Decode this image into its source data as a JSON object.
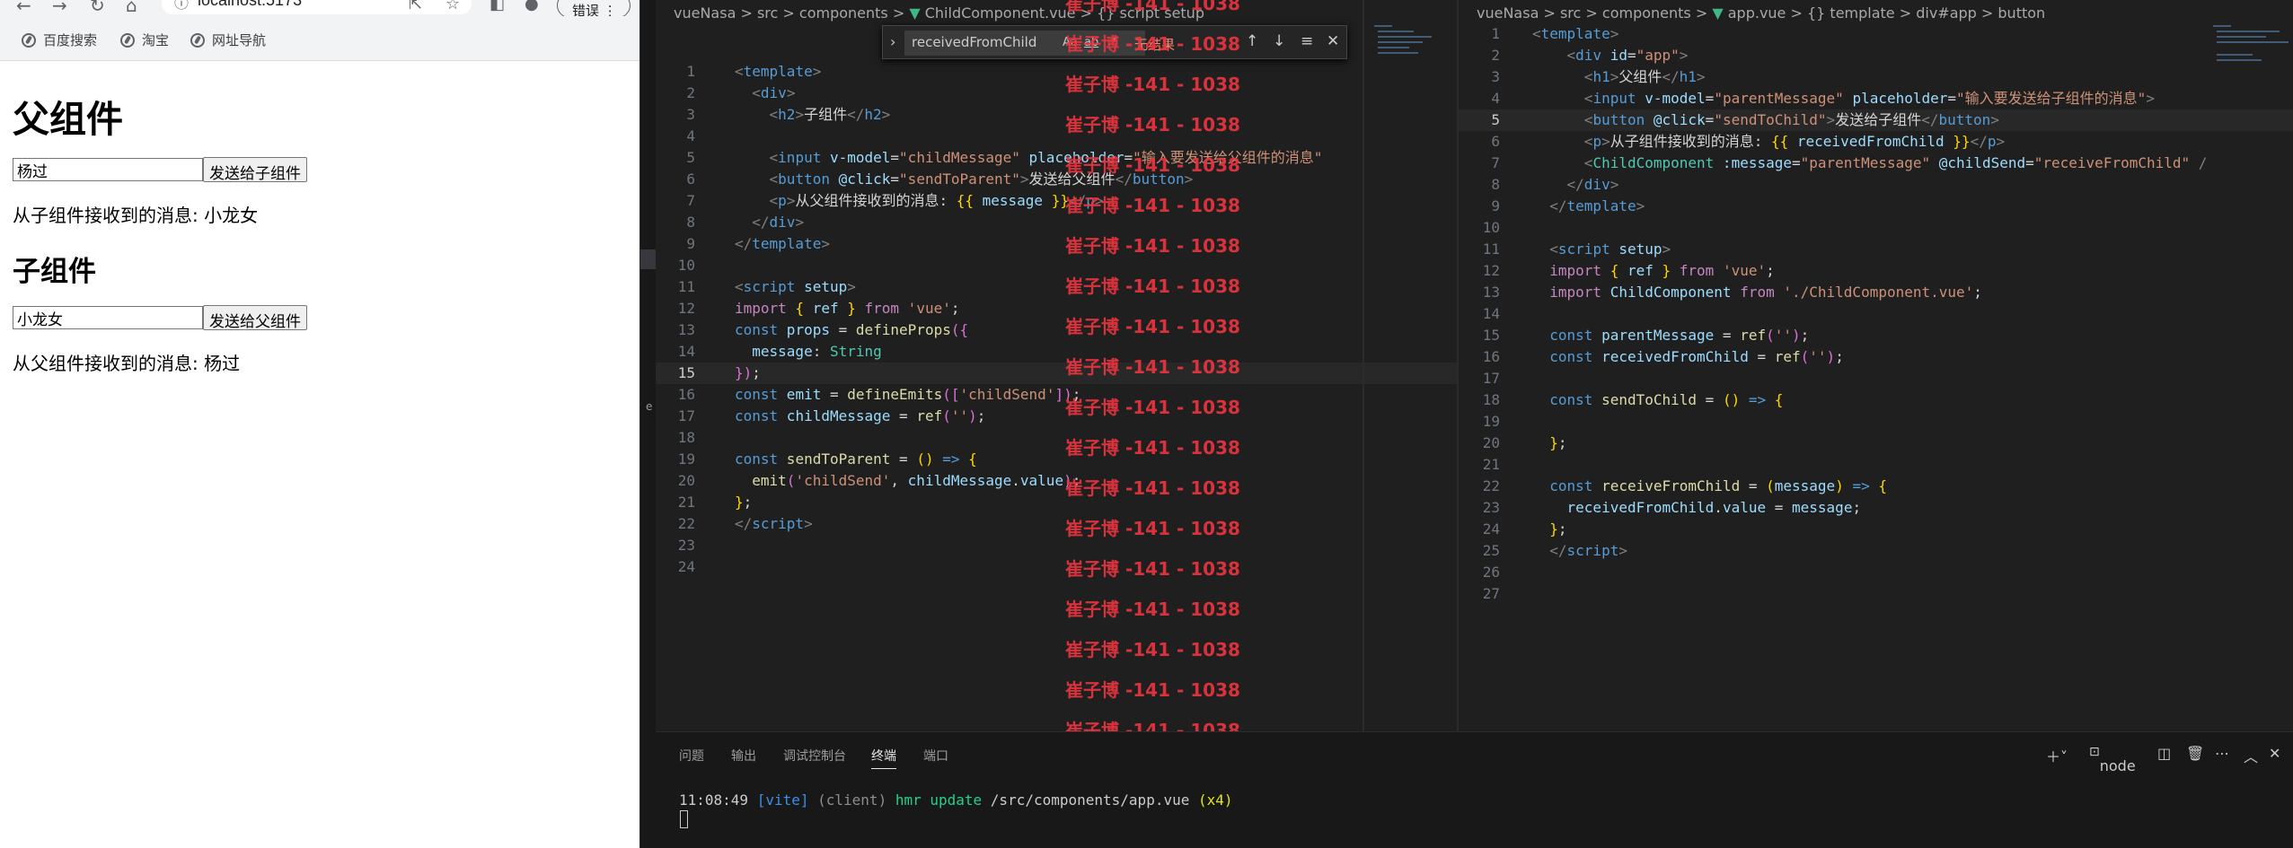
{
  "browser": {
    "url": "localhost:5173",
    "error_button": "错误",
    "bookmarks": [
      "百度搜索",
      "淘宝",
      "网址导航"
    ]
  },
  "page": {
    "parent_title": "父组件",
    "parent_input_value": "杨过",
    "parent_button": "发送给子组件",
    "parent_received": "从子组件接收到的消息: 小龙女",
    "child_title": "子组件",
    "child_input_value": "小龙女",
    "child_button": "发送给父组件",
    "child_received": "从父组件接收到的消息: 杨过"
  },
  "editor_left": {
    "breadcrumb": [
      "vueNasa",
      "src",
      "components",
      "ChildComponent.vue",
      "{} script setup"
    ],
    "active_line": 15,
    "lines": [
      [
        {
          "t": "<",
          "c": "brk"
        },
        {
          "t": "template",
          "c": "tag"
        },
        {
          "t": ">",
          "c": "brk"
        }
      ],
      [
        {
          "t": "  "
        },
        {
          "t": "<",
          "c": "brk"
        },
        {
          "t": "div",
          "c": "tag"
        },
        {
          "t": ">",
          "c": "brk"
        }
      ],
      [
        {
          "t": "    "
        },
        {
          "t": "<",
          "c": "brk"
        },
        {
          "t": "h2",
          "c": "tag"
        },
        {
          "t": ">",
          "c": "brk"
        },
        {
          "t": "子组件",
          "c": "txt"
        },
        {
          "t": "</",
          "c": "brk"
        },
        {
          "t": "h2",
          "c": "tag"
        },
        {
          "t": ">",
          "c": "brk"
        }
      ],
      [
        {
          "t": ""
        }
      ],
      [
        {
          "t": "    "
        },
        {
          "t": "<",
          "c": "brk"
        },
        {
          "t": "input",
          "c": "tag"
        },
        {
          "t": " v-model",
          "c": "attr"
        },
        {
          "t": "=",
          "c": "txt"
        },
        {
          "t": "\"childMessage\"",
          "c": "str"
        },
        {
          "t": " placeholder",
          "c": "attr"
        },
        {
          "t": "=",
          "c": "txt"
        },
        {
          "t": "\"输入要发送给父组件的消息\"",
          "c": "str"
        }
      ],
      [
        {
          "t": "    "
        },
        {
          "t": "<",
          "c": "brk"
        },
        {
          "t": "button",
          "c": "tag"
        },
        {
          "t": " @click",
          "c": "attr"
        },
        {
          "t": "=",
          "c": "txt"
        },
        {
          "t": "\"sendToParent\"",
          "c": "str"
        },
        {
          "t": ">",
          "c": "brk"
        },
        {
          "t": "发送给父组件",
          "c": "txt"
        },
        {
          "t": "</",
          "c": "brk"
        },
        {
          "t": "button",
          "c": "tag"
        },
        {
          "t": ">",
          "c": "brk"
        }
      ],
      [
        {
          "t": "    "
        },
        {
          "t": "<",
          "c": "brk"
        },
        {
          "t": "p",
          "c": "tag"
        },
        {
          "t": ">",
          "c": "brk"
        },
        {
          "t": "从父组件接收到的消息: ",
          "c": "txt"
        },
        {
          "t": "{{",
          "c": "br"
        },
        {
          "t": " message ",
          "c": "var"
        },
        {
          "t": "}}",
          "c": "br"
        },
        {
          "t": "</",
          "c": "brk"
        },
        {
          "t": "p",
          "c": "tag"
        },
        {
          "t": ">",
          "c": "brk"
        }
      ],
      [
        {
          "t": "  "
        },
        {
          "t": "</",
          "c": "brk"
        },
        {
          "t": "div",
          "c": "tag"
        },
        {
          "t": ">",
          "c": "brk"
        }
      ],
      [
        {
          "t": "</",
          "c": "brk"
        },
        {
          "t": "template",
          "c": "tag"
        },
        {
          "t": ">",
          "c": "brk"
        }
      ],
      [
        {
          "t": ""
        }
      ],
      [
        {
          "t": "<",
          "c": "brk"
        },
        {
          "t": "script",
          "c": "tag"
        },
        {
          "t": " setup",
          "c": "attr"
        },
        {
          "t": ">",
          "c": "brk"
        }
      ],
      [
        {
          "t": "import",
          "c": "imp"
        },
        {
          "t": " { ",
          "c": "br"
        },
        {
          "t": "ref",
          "c": "var"
        },
        {
          "t": " } ",
          "c": "br"
        },
        {
          "t": "from",
          "c": "imp"
        },
        {
          "t": " 'vue'",
          "c": "str"
        },
        {
          "t": ";",
          "c": "txt"
        }
      ],
      [
        {
          "t": "const",
          "c": "kw"
        },
        {
          "t": " props",
          "c": "var"
        },
        {
          "t": " = ",
          "c": "txt"
        },
        {
          "t": "defineProps",
          "c": "fn"
        },
        {
          "t": "({",
          "c": "br2"
        }
      ],
      [
        {
          "t": "  message",
          "c": "var"
        },
        {
          "t": ": ",
          "c": "txt"
        },
        {
          "t": "String",
          "c": "type"
        }
      ],
      [
        {
          "t": "})",
          "c": "br2"
        },
        {
          "t": ";",
          "c": "txt"
        }
      ],
      [
        {
          "t": "const",
          "c": "kw"
        },
        {
          "t": " emit",
          "c": "var"
        },
        {
          "t": " = ",
          "c": "txt"
        },
        {
          "t": "defineEmits",
          "c": "fn"
        },
        {
          "t": "([",
          "c": "br2"
        },
        {
          "t": "'childSend'",
          "c": "str"
        },
        {
          "t": "])",
          "c": "br2"
        },
        {
          "t": ";",
          "c": "txt"
        }
      ],
      [
        {
          "t": "const",
          "c": "kw"
        },
        {
          "t": " childMessage",
          "c": "var"
        },
        {
          "t": " = ",
          "c": "txt"
        },
        {
          "t": "ref",
          "c": "fn"
        },
        {
          "t": "(",
          "c": "br2"
        },
        {
          "t": "''",
          "c": "str"
        },
        {
          "t": ")",
          "c": "br2"
        },
        {
          "t": ";",
          "c": "txt"
        }
      ],
      [
        {
          "t": ""
        }
      ],
      [
        {
          "t": "const",
          "c": "kw"
        },
        {
          "t": " sendToParent",
          "c": "fn"
        },
        {
          "t": " = ",
          "c": "txt"
        },
        {
          "t": "()",
          "c": "br"
        },
        {
          "t": " => ",
          "c": "kw"
        },
        {
          "t": "{",
          "c": "br"
        }
      ],
      [
        {
          "t": "  emit",
          "c": "fn"
        },
        {
          "t": "(",
          "c": "br2"
        },
        {
          "t": "'childSend'",
          "c": "str"
        },
        {
          "t": ", ",
          "c": "txt"
        },
        {
          "t": "childMessage",
          "c": "var"
        },
        {
          "t": ".",
          "c": "txt"
        },
        {
          "t": "value",
          "c": "var"
        },
        {
          "t": ")",
          "c": "br2"
        },
        {
          "t": ";",
          "c": "txt"
        }
      ],
      [
        {
          "t": "}",
          "c": "br"
        },
        {
          "t": ";",
          "c": "txt"
        }
      ],
      [
        {
          "t": "</",
          "c": "brk"
        },
        {
          "t": "script",
          "c": "tag"
        },
        {
          "t": ">",
          "c": "brk"
        }
      ],
      [
        {
          "t": ""
        }
      ],
      [
        {
          "t": ""
        }
      ]
    ]
  },
  "find": {
    "query": "receivedFromChild",
    "options": [
      "Aa",
      "ab",
      ".*"
    ],
    "result": "无结果"
  },
  "watermark": "崔子博 -141 - 1038",
  "editor_right": {
    "breadcrumb": [
      "vueNasa",
      "src",
      "components",
      "app.vue",
      "{} template",
      "div#app",
      "button"
    ],
    "active_line": 5,
    "lines": [
      [
        {
          "t": "<",
          "c": "brk"
        },
        {
          "t": "template",
          "c": "tag"
        },
        {
          "t": ">",
          "c": "brk"
        }
      ],
      [
        {
          "t": "    "
        },
        {
          "t": "<",
          "c": "brk"
        },
        {
          "t": "div",
          "c": "tag"
        },
        {
          "t": " id",
          "c": "attr"
        },
        {
          "t": "=",
          "c": "txt"
        },
        {
          "t": "\"app\"",
          "c": "str"
        },
        {
          "t": ">",
          "c": "brk"
        }
      ],
      [
        {
          "t": "      "
        },
        {
          "t": "<",
          "c": "brk"
        },
        {
          "t": "h1",
          "c": "tag"
        },
        {
          "t": ">",
          "c": "brk"
        },
        {
          "t": "父组件",
          "c": "txt"
        },
        {
          "t": "</",
          "c": "brk"
        },
        {
          "t": "h1",
          "c": "tag"
        },
        {
          "t": ">",
          "c": "brk"
        }
      ],
      [
        {
          "t": "      "
        },
        {
          "t": "<",
          "c": "brk"
        },
        {
          "t": "input",
          "c": "tag"
        },
        {
          "t": " v-model",
          "c": "attr"
        },
        {
          "t": "=",
          "c": "txt"
        },
        {
          "t": "\"parentMessage\"",
          "c": "str"
        },
        {
          "t": " placeholder",
          "c": "attr"
        },
        {
          "t": "=",
          "c": "txt"
        },
        {
          "t": "\"输入要发送给子组件的消息\"",
          "c": "str"
        },
        {
          "t": ">",
          "c": "brk"
        }
      ],
      [
        {
          "t": "      "
        },
        {
          "t": "<",
          "c": "brk"
        },
        {
          "t": "button",
          "c": "tag"
        },
        {
          "t": " @click",
          "c": "attr"
        },
        {
          "t": "=",
          "c": "txt"
        },
        {
          "t": "\"sendToChild\"",
          "c": "str"
        },
        {
          "t": ">",
          "c": "brk"
        },
        {
          "t": "发送给子组件",
          "c": "txt"
        },
        {
          "t": "</",
          "c": "brk"
        },
        {
          "t": "button",
          "c": "tag"
        },
        {
          "t": ">",
          "c": "brk"
        }
      ],
      [
        {
          "t": "      "
        },
        {
          "t": "<",
          "c": "brk"
        },
        {
          "t": "p",
          "c": "tag"
        },
        {
          "t": ">",
          "c": "brk"
        },
        {
          "t": "从子组件接收到的消息: ",
          "c": "txt"
        },
        {
          "t": "{{",
          "c": "br"
        },
        {
          "t": " receivedFromChild ",
          "c": "var"
        },
        {
          "t": "}}",
          "c": "br"
        },
        {
          "t": "</",
          "c": "brk"
        },
        {
          "t": "p",
          "c": "tag"
        },
        {
          "t": ">",
          "c": "brk"
        }
      ],
      [
        {
          "t": "      "
        },
        {
          "t": "<",
          "c": "brk"
        },
        {
          "t": "ChildComponent",
          "c": "ent"
        },
        {
          "t": " :message",
          "c": "attr"
        },
        {
          "t": "=",
          "c": "txt"
        },
        {
          "t": "\"parentMessage\"",
          "c": "str"
        },
        {
          "t": " @childSend",
          "c": "attr"
        },
        {
          "t": "=",
          "c": "txt"
        },
        {
          "t": "\"receiveFromChild\"",
          "c": "str"
        },
        {
          "t": " /",
          "c": "brk"
        }
      ],
      [
        {
          "t": "    "
        },
        {
          "t": "</",
          "c": "brk"
        },
        {
          "t": "div",
          "c": "tag"
        },
        {
          "t": ">",
          "c": "brk"
        }
      ],
      [
        {
          "t": "  "
        },
        {
          "t": "</",
          "c": "brk"
        },
        {
          "t": "template",
          "c": "tag"
        },
        {
          "t": ">",
          "c": "brk"
        }
      ],
      [
        {
          "t": ""
        }
      ],
      [
        {
          "t": "  "
        },
        {
          "t": "<",
          "c": "brk"
        },
        {
          "t": "script",
          "c": "tag"
        },
        {
          "t": " setup",
          "c": "attr"
        },
        {
          "t": ">",
          "c": "brk"
        }
      ],
      [
        {
          "t": "  "
        },
        {
          "t": "import",
          "c": "imp"
        },
        {
          "t": " { ",
          "c": "br"
        },
        {
          "t": "ref",
          "c": "var"
        },
        {
          "t": " } ",
          "c": "br"
        },
        {
          "t": "from",
          "c": "imp"
        },
        {
          "t": " 'vue'",
          "c": "str"
        },
        {
          "t": ";",
          "c": "txt"
        }
      ],
      [
        {
          "t": "  "
        },
        {
          "t": "import",
          "c": "imp"
        },
        {
          "t": " ChildComponent",
          "c": "var"
        },
        {
          "t": " from",
          "c": "imp"
        },
        {
          "t": " './ChildComponent.vue'",
          "c": "str"
        },
        {
          "t": ";",
          "c": "txt"
        }
      ],
      [
        {
          "t": ""
        }
      ],
      [
        {
          "t": "  "
        },
        {
          "t": "const",
          "c": "kw"
        },
        {
          "t": " parentMessage",
          "c": "var"
        },
        {
          "t": " = ",
          "c": "txt"
        },
        {
          "t": "ref",
          "c": "fn"
        },
        {
          "t": "(",
          "c": "br2"
        },
        {
          "t": "''",
          "c": "str"
        },
        {
          "t": ")",
          "c": "br2"
        },
        {
          "t": ";",
          "c": "txt"
        }
      ],
      [
        {
          "t": "  "
        },
        {
          "t": "const",
          "c": "kw"
        },
        {
          "t": " receivedFromChild",
          "c": "var"
        },
        {
          "t": " = ",
          "c": "txt"
        },
        {
          "t": "ref",
          "c": "fn"
        },
        {
          "t": "(",
          "c": "br2"
        },
        {
          "t": "''",
          "c": "str"
        },
        {
          "t": ")",
          "c": "br2"
        },
        {
          "t": ";",
          "c": "txt"
        }
      ],
      [
        {
          "t": ""
        }
      ],
      [
        {
          "t": "  "
        },
        {
          "t": "const",
          "c": "kw"
        },
        {
          "t": " sendToChild",
          "c": "fn"
        },
        {
          "t": " = ",
          "c": "txt"
        },
        {
          "t": "()",
          "c": "br"
        },
        {
          "t": " => ",
          "c": "kw"
        },
        {
          "t": "{",
          "c": "br"
        }
      ],
      [
        {
          "t": ""
        }
      ],
      [
        {
          "t": "  "
        },
        {
          "t": "}",
          "c": "br"
        },
        {
          "t": ";",
          "c": "txt"
        }
      ],
      [
        {
          "t": ""
        }
      ],
      [
        {
          "t": "  "
        },
        {
          "t": "const",
          "c": "kw"
        },
        {
          "t": " receiveFromChild",
          "c": "fn"
        },
        {
          "t": " = ",
          "c": "txt"
        },
        {
          "t": "(",
          "c": "br"
        },
        {
          "t": "message",
          "c": "var"
        },
        {
          "t": ")",
          "c": "br"
        },
        {
          "t": " => ",
          "c": "kw"
        },
        {
          "t": "{",
          "c": "br"
        }
      ],
      [
        {
          "t": "    receivedFromChild",
          "c": "var"
        },
        {
          "t": ".",
          "c": "txt"
        },
        {
          "t": "value",
          "c": "var"
        },
        {
          "t": " = ",
          "c": "txt"
        },
        {
          "t": "message",
          "c": "var"
        },
        {
          "t": ";",
          "c": "txt"
        }
      ],
      [
        {
          "t": "  "
        },
        {
          "t": "}",
          "c": "br"
        },
        {
          "t": ";",
          "c": "txt"
        }
      ],
      [
        {
          "t": "  "
        },
        {
          "t": "</",
          "c": "brk"
        },
        {
          "t": "script",
          "c": "tag"
        },
        {
          "t": ">",
          "c": "brk"
        }
      ],
      [
        {
          "t": ""
        }
      ],
      [
        {
          "t": ""
        }
      ]
    ]
  },
  "panel": {
    "tabs": [
      "问题",
      "输出",
      "调试控制台",
      "终端",
      "端口"
    ],
    "active_tab": "终端",
    "terminal_profile": "node",
    "terminal_line": [
      {
        "t": "11:08:49 ",
        "c": "#cccccc"
      },
      {
        "t": "[vite]",
        "c": "#3b8eea"
      },
      {
        "t": " (client) ",
        "c": "#8c8c8c"
      },
      {
        "t": "hmr update ",
        "c": "#23d18b"
      },
      {
        "t": "/src/components/app.vue ",
        "c": "#cccccc"
      },
      {
        "t": "(x4)",
        "c": "#e5e510"
      }
    ]
  },
  "colors": {
    "editor_bg": "#1f1f1f",
    "watermark": "#e8353f",
    "vue_icon": "#41b883"
  }
}
